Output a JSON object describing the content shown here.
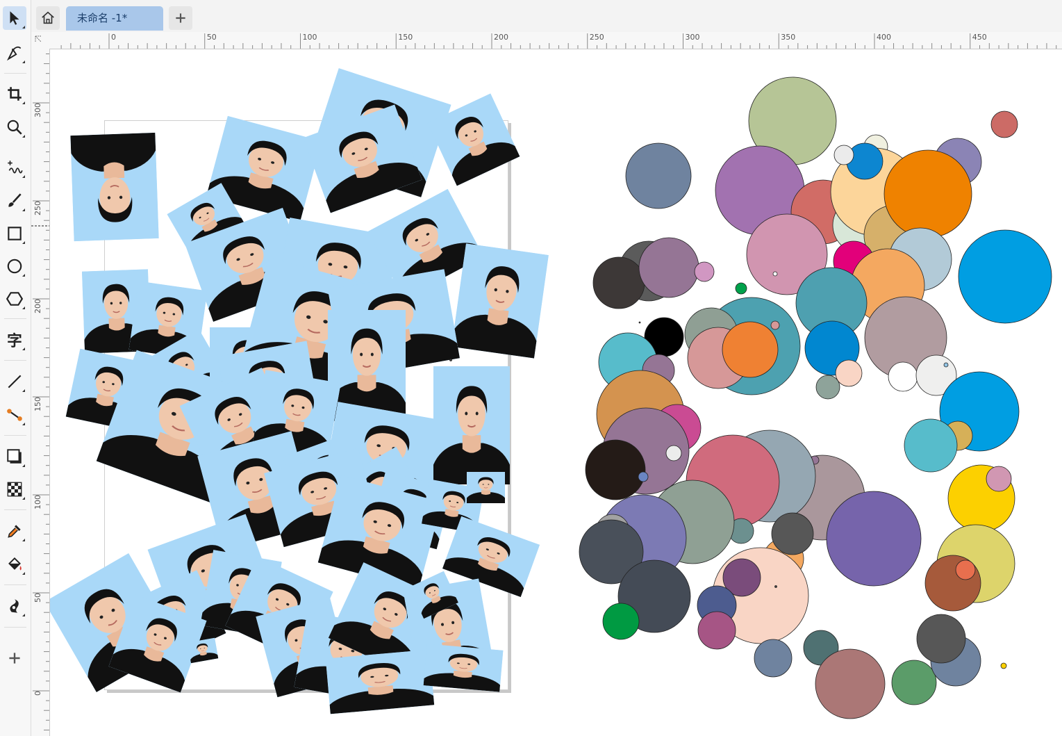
{
  "app": {
    "tab": {
      "title": "未命名 -1*"
    },
    "toolbar": {
      "tools": [
        {
          "name": "select-tool",
          "icon": "arrow-pointer-icon"
        },
        {
          "name": "node-tool",
          "icon": "node-edit-icon"
        },
        {
          "name": "crop-tool",
          "icon": "crop-icon"
        },
        {
          "name": "zoom-tool",
          "icon": "magnifier-icon"
        },
        {
          "name": "freehand-tool",
          "icon": "freehand-curve-icon"
        },
        {
          "name": "brush-tool",
          "icon": "brush-icon"
        },
        {
          "name": "rectangle-tool",
          "icon": "rectangle-icon"
        },
        {
          "name": "ellipse-tool",
          "icon": "ellipse-icon"
        },
        {
          "name": "polygon-tool",
          "icon": "hexagon-icon"
        },
        {
          "name": "text-tool",
          "icon": "text-zi-icon"
        },
        {
          "name": "line-tool",
          "icon": "line-icon"
        },
        {
          "name": "connector-tool",
          "icon": "connector-icon"
        },
        {
          "name": "shadow-tool",
          "icon": "drop-shadow-icon"
        },
        {
          "name": "transparency-tool",
          "icon": "checkerboard-icon"
        },
        {
          "name": "eyedropper-tool",
          "icon": "eyedropper-icon"
        },
        {
          "name": "fill-tool",
          "icon": "paint-bucket-icon"
        },
        {
          "name": "smart-fill-tool",
          "icon": "smart-drawing-icon"
        },
        {
          "name": "add-tool",
          "icon": "plus-icon"
        }
      ]
    },
    "ruler": {
      "top_labels": [
        "0",
        "50",
        "100",
        "150",
        "200",
        "250",
        "300",
        "350",
        "400",
        "450"
      ],
      "left_labels": [
        "300",
        "250",
        "200",
        "150",
        "100",
        "50",
        "0"
      ]
    },
    "colors": {
      "accent": "#a9c7ea",
      "photo_bg": "#a9d8f8"
    }
  }
}
